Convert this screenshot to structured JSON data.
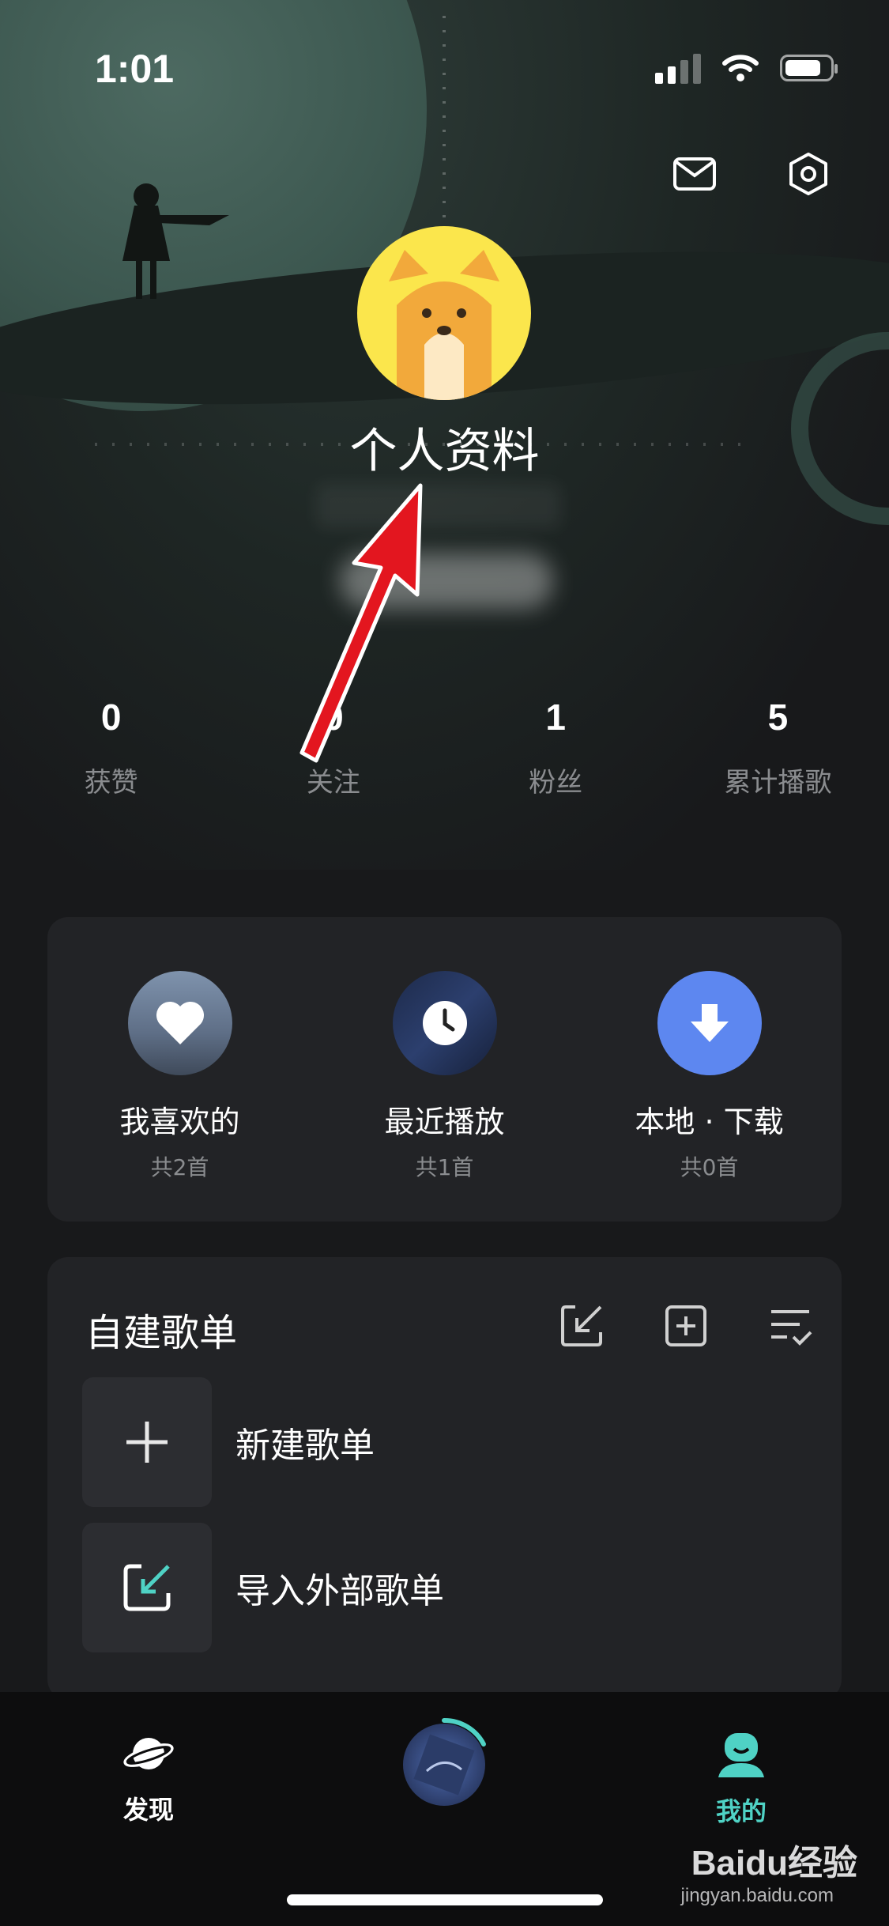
{
  "status": {
    "time": "1:01"
  },
  "profile": {
    "title": "个人资料"
  },
  "stats": [
    {
      "value": "0",
      "label": "获赞"
    },
    {
      "value": "0",
      "label": "关注"
    },
    {
      "value": "1",
      "label": "粉丝"
    },
    {
      "value": "5",
      "label": "累计播歌"
    }
  ],
  "quick": [
    {
      "label": "我喜欢的",
      "sub": "共2首",
      "icon": "heart-icon"
    },
    {
      "label": "最近播放",
      "sub": "共1首",
      "icon": "clock-icon"
    },
    {
      "label": "本地 · 下载",
      "sub": "共0首",
      "icon": "download-icon"
    }
  ],
  "playlists": {
    "title": "自建歌单",
    "items": [
      {
        "label": "新建歌单",
        "icon": "plus-icon"
      },
      {
        "label": "导入外部歌单",
        "icon": "import-icon"
      }
    ]
  },
  "tabs": [
    {
      "label": "发现",
      "icon": "planet-icon"
    },
    {
      "label": "我的",
      "icon": "profile-icon"
    }
  ],
  "watermark": {
    "brand": "Baidu经验",
    "url": "jingyan.baidu.com"
  },
  "colors": {
    "accent": "#4fd2c5",
    "download": "#5d87f0",
    "avatar": "#fbe64c"
  }
}
